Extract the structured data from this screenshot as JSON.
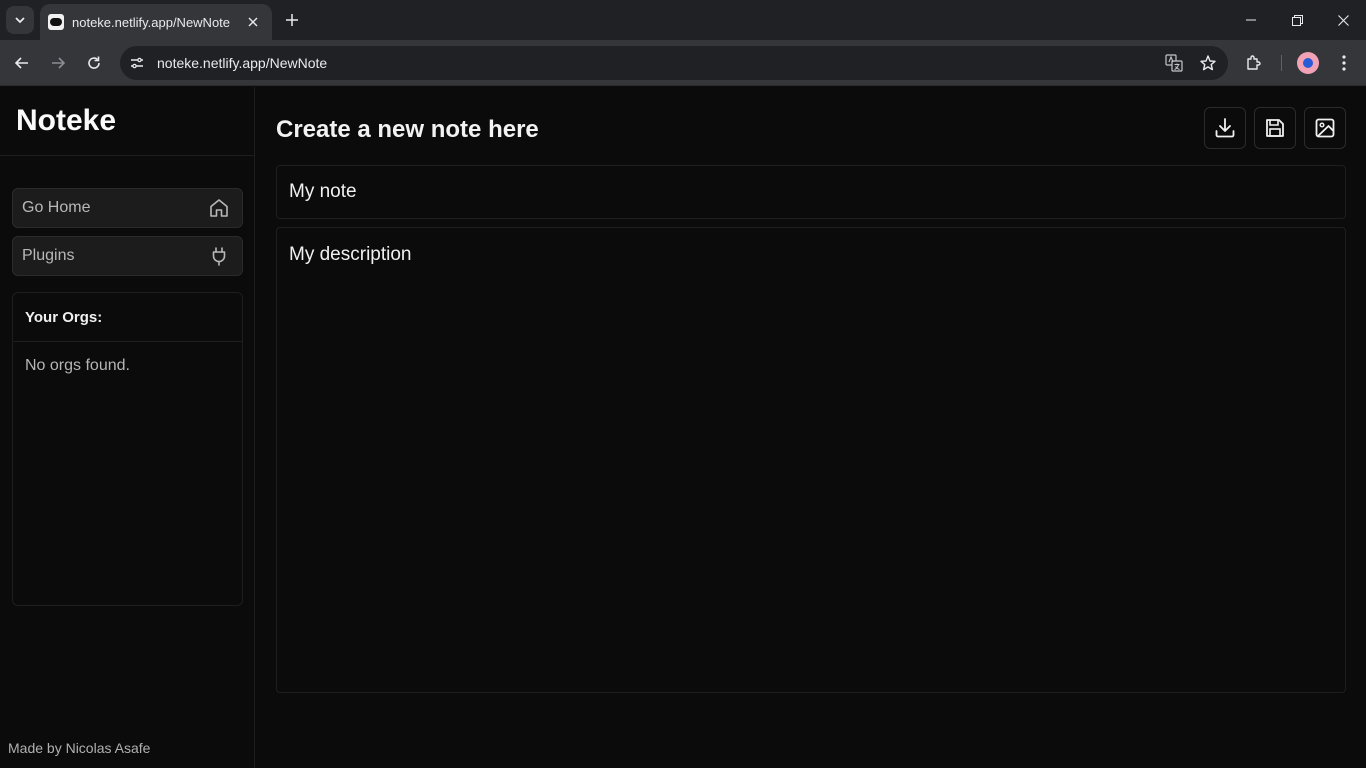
{
  "browser": {
    "tab_title": "noteke.netlify.app/NewNote",
    "url": "noteke.netlify.app/NewNote"
  },
  "sidebar": {
    "brand": "Noteke",
    "items": [
      {
        "label": "Go Home",
        "icon": "home-icon"
      },
      {
        "label": "Plugins",
        "icon": "plug-icon"
      }
    ],
    "orgs_title": "Your Orgs:",
    "orgs_empty": "No orgs found.",
    "credit": "Made by Nicolas Asafe"
  },
  "main": {
    "title": "Create a new note here",
    "actions": [
      {
        "icon": "download-icon"
      },
      {
        "icon": "save-icon"
      },
      {
        "icon": "image-icon"
      }
    ],
    "note_title_value": "My note",
    "note_description_value": "My description"
  }
}
